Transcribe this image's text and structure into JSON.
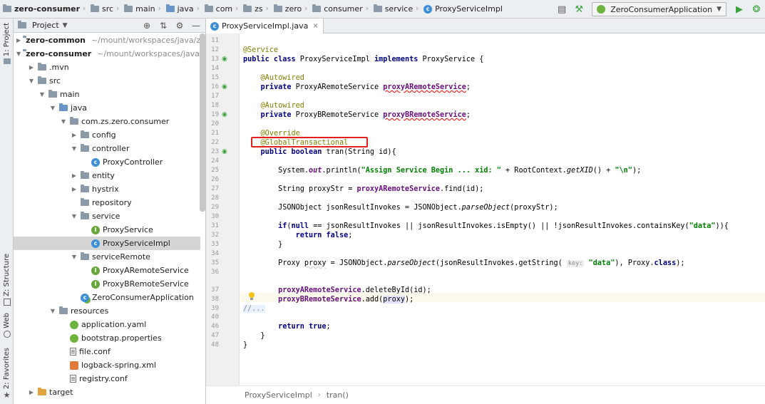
{
  "breadcrumbs": [
    {
      "label": "zero-consumer",
      "icon": "module-folder-icon",
      "bold": true
    },
    {
      "label": "src",
      "icon": "folder-icon"
    },
    {
      "label": "main",
      "icon": "folder-icon"
    },
    {
      "label": "java",
      "icon": "source-folder-icon"
    },
    {
      "label": "com",
      "icon": "package-icon"
    },
    {
      "label": "zs",
      "icon": "package-icon"
    },
    {
      "label": "zero",
      "icon": "package-icon"
    },
    {
      "label": "consumer",
      "icon": "package-icon"
    },
    {
      "label": "service",
      "icon": "package-icon"
    },
    {
      "label": "ProxyServiceImpl",
      "icon": "class-icon"
    }
  ],
  "toolbar": {
    "run_config": "ZeroConsumerApplication"
  },
  "tool_strip": {
    "project": "1: Project",
    "structure": "Z: Structure",
    "web": "Web",
    "favorites": "2: Favorites"
  },
  "project_panel": {
    "title": "Project"
  },
  "tree": [
    {
      "label": "zero-common",
      "path": "~/mount/workspaces/java/z",
      "indent": 0,
      "arrow": "right",
      "icon": "module-folder-icon",
      "bold": true
    },
    {
      "label": "zero-consumer",
      "path": "~/mount/workspaces/java/",
      "indent": 0,
      "arrow": "down",
      "icon": "module-folder-icon",
      "bold": true
    },
    {
      "label": ".mvn",
      "indent": 1,
      "arrow": "right",
      "icon": "folder-icon"
    },
    {
      "label": "src",
      "indent": 1,
      "arrow": "down",
      "icon": "folder-icon"
    },
    {
      "label": "main",
      "indent": 2,
      "arrow": "down",
      "icon": "folder-icon"
    },
    {
      "label": "java",
      "indent": 3,
      "arrow": "down",
      "icon": "source-folder-icon"
    },
    {
      "label": "com.zs.zero.consumer",
      "indent": 4,
      "arrow": "down",
      "icon": "package-icon"
    },
    {
      "label": "config",
      "indent": 5,
      "arrow": "right",
      "icon": "package-icon"
    },
    {
      "label": "controller",
      "indent": 5,
      "arrow": "down",
      "icon": "package-icon"
    },
    {
      "label": "ProxyController",
      "indent": 6,
      "arrow": "",
      "icon": "class-icon"
    },
    {
      "label": "entity",
      "indent": 5,
      "arrow": "right",
      "icon": "package-icon"
    },
    {
      "label": "hystrix",
      "indent": 5,
      "arrow": "right",
      "icon": "package-icon"
    },
    {
      "label": "repository",
      "indent": 5,
      "arrow": "",
      "icon": "package-icon"
    },
    {
      "label": "service",
      "indent": 5,
      "arrow": "down",
      "icon": "package-icon"
    },
    {
      "label": "ProxyService",
      "indent": 6,
      "arrow": "",
      "icon": "interface-icon"
    },
    {
      "label": "ProxyServiceImpl",
      "indent": 6,
      "arrow": "",
      "icon": "class-icon",
      "selected": true
    },
    {
      "label": "serviceRemote",
      "indent": 5,
      "arrow": "down",
      "icon": "package-icon"
    },
    {
      "label": "ProxyARemoteService",
      "indent": 6,
      "arrow": "",
      "icon": "interface-icon"
    },
    {
      "label": "ProxyBRemoteService",
      "indent": 6,
      "arrow": "",
      "icon": "interface-icon"
    },
    {
      "label": "ZeroConsumerApplication",
      "indent": 5,
      "arrow": "",
      "icon": "spring-boot-class-icon"
    },
    {
      "label": "resources",
      "indent": 3,
      "arrow": "down",
      "icon": "resources-folder-icon"
    },
    {
      "label": "application.yaml",
      "indent": 4,
      "arrow": "",
      "icon": "spring-config-icon"
    },
    {
      "label": "bootstrap.properties",
      "indent": 4,
      "arrow": "",
      "icon": "spring-config-icon"
    },
    {
      "label": "file.conf",
      "indent": 4,
      "arrow": "",
      "icon": "text-file-icon"
    },
    {
      "label": "logback-spring.xml",
      "indent": 4,
      "arrow": "",
      "icon": "xml-file-icon"
    },
    {
      "label": "registry.conf",
      "indent": 4,
      "arrow": "",
      "icon": "text-file-icon"
    },
    {
      "label": "target",
      "indent": 1,
      "arrow": "right",
      "icon": "excluded-folder-icon"
    }
  ],
  "editor": {
    "tab_label": "ProxyServiceImpl.java",
    "gutter_numbers": [
      "11",
      "12",
      "13",
      "14",
      "15",
      "16",
      "17",
      "18",
      "19",
      "20",
      "21",
      "22",
      "23",
      "24",
      "25",
      "26",
      "27",
      "28",
      "29",
      "30",
      "31",
      "32",
      "33",
      "34",
      "35",
      "36",
      "37",
      "38",
      "39",
      "40",
      "46",
      "47",
      "48"
    ]
  },
  "status_bar": {
    "class_name": "ProxyServiceImpl",
    "method_name": "tran()"
  }
}
